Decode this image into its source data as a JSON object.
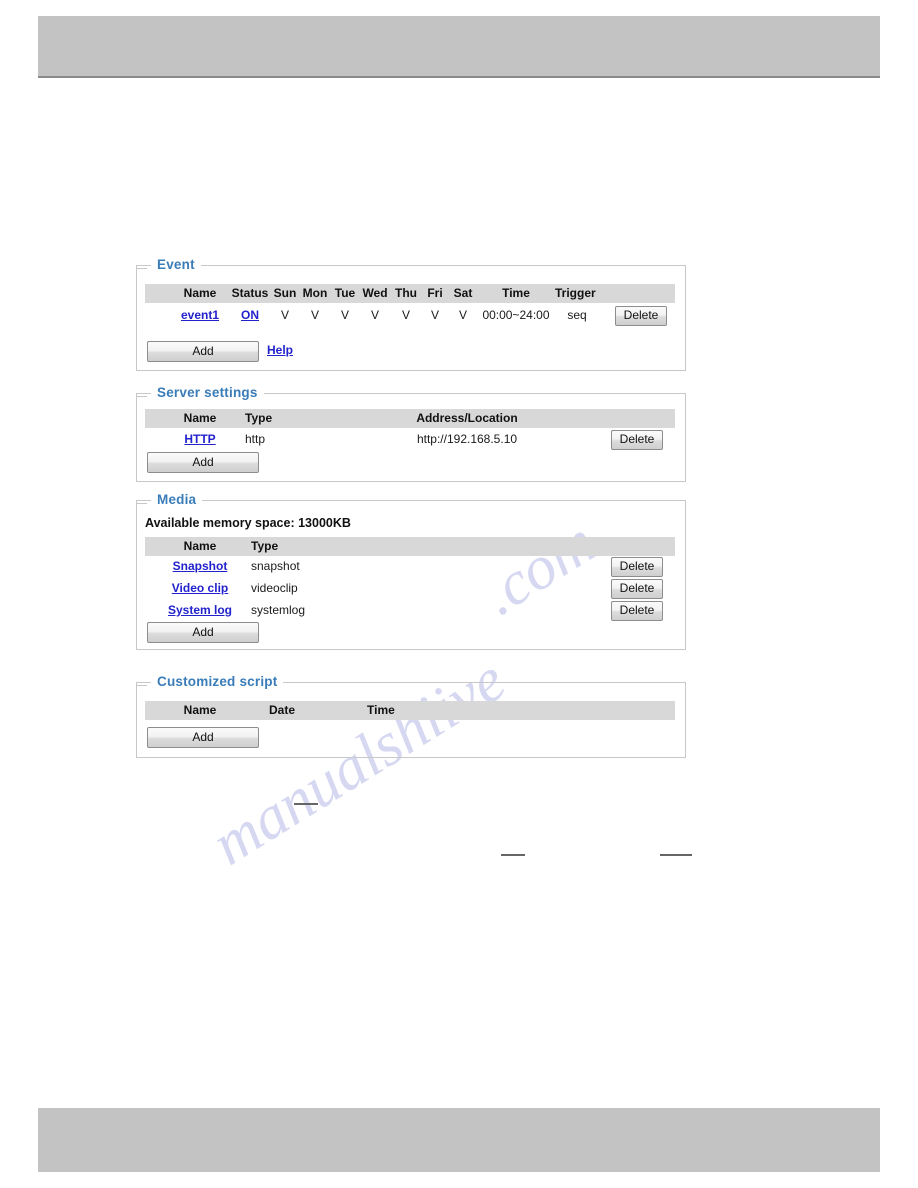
{
  "page": {
    "header_label": "page-header-band",
    "footer_label": "page-footer-band"
  },
  "watermark": {
    "line1": "manualshiive",
    "line2": ".com"
  },
  "event": {
    "legend": "Event",
    "columns": [
      "Name",
      "Status",
      "Sun",
      "Mon",
      "Tue",
      "Wed",
      "Thu",
      "Fri",
      "Sat",
      "Time",
      "Trigger"
    ],
    "rows": [
      {
        "name": "event1",
        "status": "ON",
        "sun": "V",
        "mon": "V",
        "tue": "V",
        "wed": "V",
        "thu": "V",
        "fri": "V",
        "sat": "V",
        "time": "00:00~24:00",
        "trigger": "seq",
        "delete_label": "Delete"
      }
    ],
    "add_label": "Add",
    "help_label": "Help"
  },
  "server_settings": {
    "legend": "Server settings",
    "columns": [
      "Name",
      "Type",
      "Address/Location"
    ],
    "rows": [
      {
        "name": "HTTP",
        "type": "http",
        "address": "http://192.168.5.10",
        "delete_label": "Delete"
      }
    ],
    "add_label": "Add"
  },
  "media": {
    "legend": "Media",
    "memory_text": "Available memory space: 13000KB",
    "columns": [
      "Name",
      "Type"
    ],
    "rows": [
      {
        "name": "Snapshot",
        "type": "snapshot",
        "delete_label": "Delete"
      },
      {
        "name": "Video clip",
        "type": "videoclip",
        "delete_label": "Delete"
      },
      {
        "name": "System log",
        "type": "systemlog",
        "delete_label": "Delete"
      }
    ],
    "add_label": "Add"
  },
  "customized_script": {
    "legend": "Customized script",
    "columns": [
      "Name",
      "Date",
      "Time"
    ],
    "rows": [],
    "add_label": "Add"
  },
  "colors": {
    "legend_blue": "#3a7cb8",
    "link_blue": "#2222cc",
    "band_gray": "#c3c3c3",
    "thead_gray": "#d8d8d8",
    "panel_border": "#c8c8c8"
  }
}
